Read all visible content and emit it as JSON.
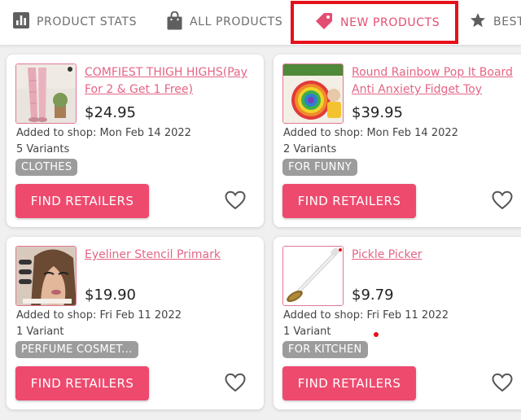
{
  "tabs": [
    {
      "label": "PRODUCT STATS",
      "icon": "bar-chart-icon",
      "active": false
    },
    {
      "label": "ALL PRODUCTS",
      "icon": "shopping-bag-icon",
      "active": false
    },
    {
      "label": "NEW PRODUCTS",
      "icon": "price-tag-icon",
      "active": true
    },
    {
      "label": "BEST",
      "icon": "star-icon",
      "active": false
    }
  ],
  "products": [
    {
      "title": "COMFIEST THIGH HIGHS(Pay For 2 & Get 1 Free)",
      "price": "$24.95",
      "added": "Added to shop: Mon Feb 14 2022",
      "variants": "5 Variants",
      "tag": "CLOTHES",
      "button": "FIND RETAILERS",
      "image": "thigh-highs-photo"
    },
    {
      "title": "Round Rainbow Pop It Board Anti Anxiety Fidget Toy",
      "price": "$39.95",
      "added": "Added to shop: Mon Feb 14 2022",
      "variants": "2 Variants",
      "tag": "FOR FUNNY",
      "button": "FIND RETAILERS",
      "image": "rainbow-pop-it-photo"
    },
    {
      "title": "Eyeliner Stencil Primark",
      "price": "$19.90",
      "added": "Added to shop: Fri Feb 11 2022",
      "variants": "1 Variant",
      "tag": "PERFUME COSMET...",
      "button": "FIND RETAILERS",
      "image": "eyeliner-model-photo"
    },
    {
      "title": "Pickle Picker",
      "price": "$9.79",
      "added": "Added to shop: Fri Feb 11 2022",
      "variants": "1 Variant",
      "tag": "FOR KITCHEN",
      "button": "FIND RETAILERS",
      "image": "pickle-picker-photo"
    }
  ],
  "colors": {
    "accent": "#ee4a6e",
    "link": "#e46585",
    "highlight_border": "#e5101a",
    "tag_bg": "#9c9c9c"
  }
}
